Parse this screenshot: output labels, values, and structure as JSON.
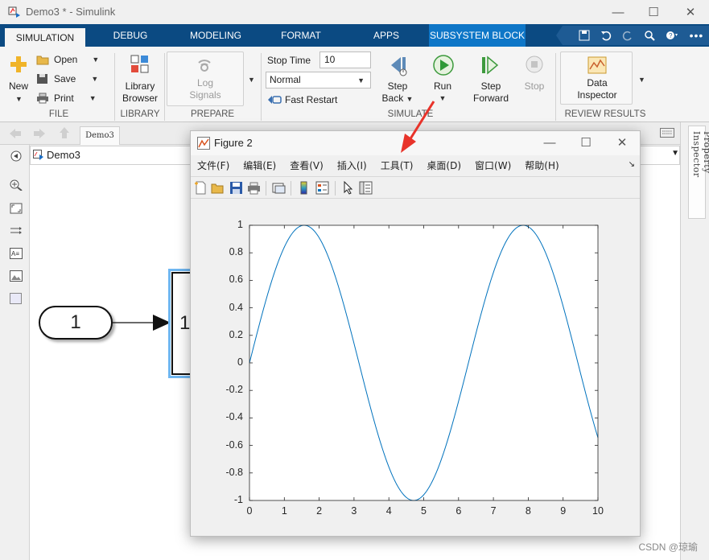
{
  "window": {
    "title": "Demo3 * - Simulink"
  },
  "tabs": [
    {
      "label": "SIMULATION",
      "active": true
    },
    {
      "label": "DEBUG"
    },
    {
      "label": "MODELING"
    },
    {
      "label": "FORMAT"
    },
    {
      "label": "APPS"
    },
    {
      "label": "SUBSYSTEM BLOCK",
      "contextual": true
    }
  ],
  "ribbon": {
    "file": {
      "label": "FILE",
      "new": "New",
      "open": "Open",
      "save": "Save",
      "print": "Print"
    },
    "library": {
      "label": "LIBRARY",
      "browser_line1": "Library",
      "browser_line2": "Browser"
    },
    "prepare": {
      "label": "PREPARE",
      "log_line1": "Log",
      "log_line2": "Signals"
    },
    "simulate": {
      "label": "SIMULATE",
      "stop_time_label": "Stop Time",
      "stop_time_value": "10",
      "mode_value": "Normal",
      "fast_restart": "Fast Restart",
      "step_back_line1": "Step",
      "step_back_line2": "Back",
      "run": "Run",
      "step_forward_line1": "Step",
      "step_forward_line2": "Forward",
      "stop": "Stop"
    },
    "review": {
      "label": "REVIEW RESULTS",
      "data_line1": "Data",
      "data_line2": "Inspector"
    }
  },
  "editor": {
    "doc_tab": "Demo3",
    "address": "Demo3",
    "property_inspector": "Property Inspector",
    "constant_value": "1",
    "subsystem_port": "1"
  },
  "figure": {
    "title": "Figure 2",
    "menu": [
      "文件(F)",
      "编辑(E)",
      "查看(V)",
      "插入(I)",
      "工具(T)",
      "桌面(D)",
      "窗口(W)",
      "帮助(H)"
    ]
  },
  "chart_data": {
    "type": "line",
    "function": "sin(x)",
    "x_range": [
      0,
      10
    ],
    "xlim": [
      0,
      10
    ],
    "ylim": [
      -1,
      1
    ],
    "xticks": [
      "0",
      "1",
      "2",
      "3",
      "4",
      "5",
      "6",
      "7",
      "8",
      "9",
      "10"
    ],
    "yticks": [
      "1",
      "0.8",
      "0.6",
      "0.4",
      "0.2",
      "0",
      "-0.2",
      "-0.4",
      "-0.6",
      "-0.8",
      "-1"
    ],
    "series": [
      {
        "color": "#0072bd"
      }
    ],
    "grid": false,
    "box": true
  },
  "watermark": "CSDN @琼瑜"
}
